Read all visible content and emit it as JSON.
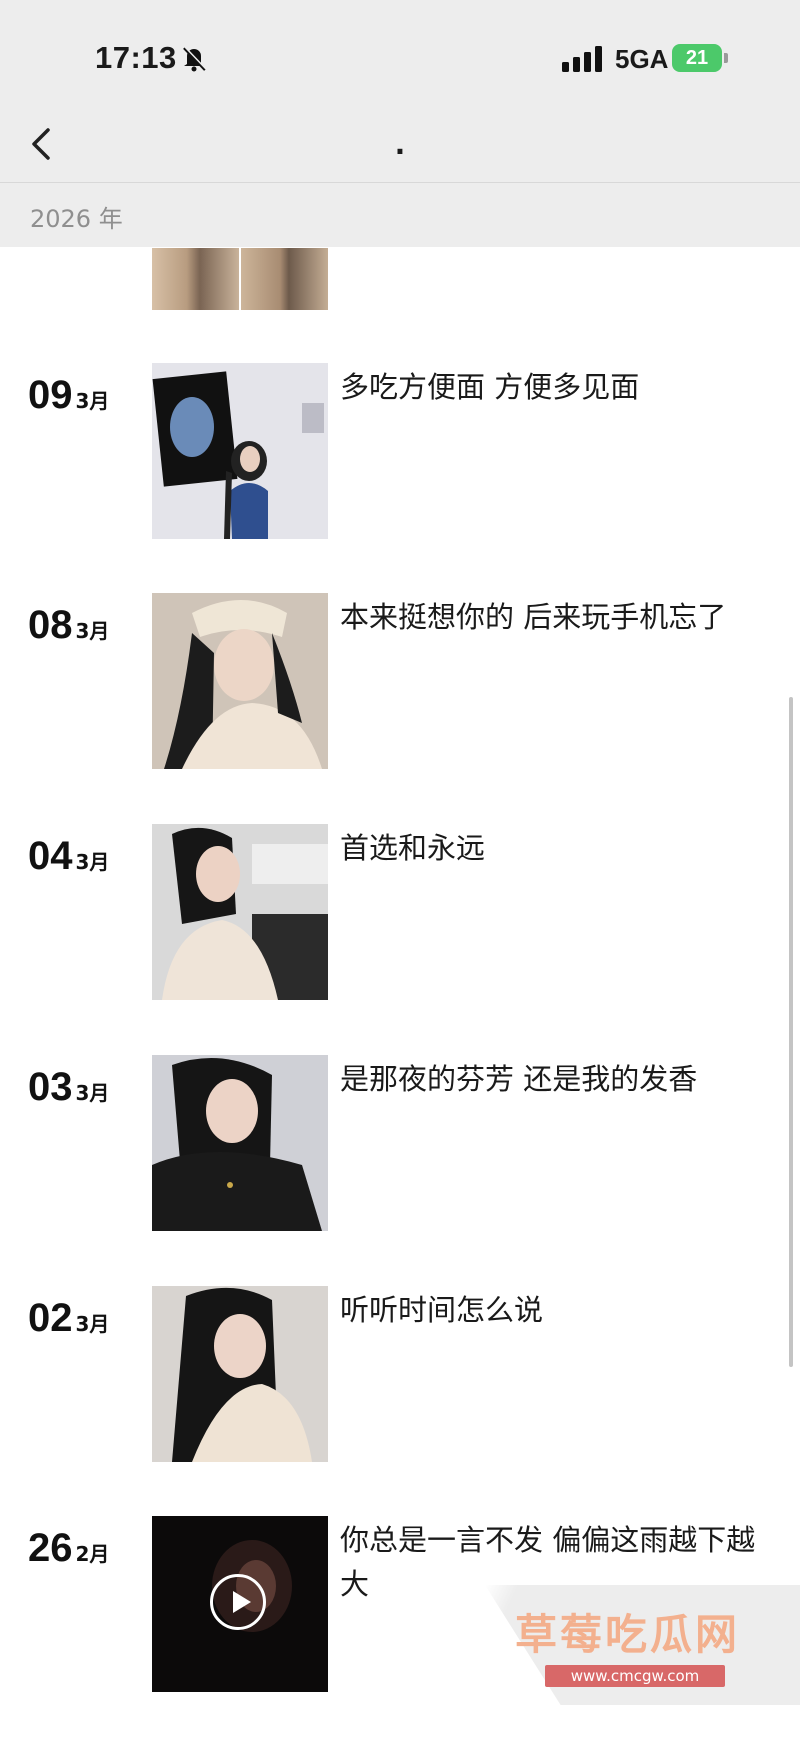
{
  "status": {
    "time": "17:13",
    "network": "5GA",
    "battery": "21"
  },
  "nav": {
    "title": "."
  },
  "year_label": "2026 年",
  "entries": [
    {
      "day": "09",
      "month": "3月",
      "caption": "多吃方便面 方便多见面"
    },
    {
      "day": "08",
      "month": "3月",
      "caption": "本来挺想你的 后来玩手机忘了"
    },
    {
      "day": "04",
      "month": "3月",
      "caption": "首选和永远"
    },
    {
      "day": "03",
      "month": "3月",
      "caption": "是那夜的芬芳 还是我的发香"
    },
    {
      "day": "02",
      "month": "3月",
      "caption": "听听时间怎么说"
    },
    {
      "day": "26",
      "month": "2月",
      "caption": "你总是一言不发 偏偏这雨越下越大"
    }
  ],
  "watermark": {
    "name": "草莓吃瓜网",
    "url": "www.cmcgw.com"
  },
  "colors": {
    "bar_bg": "#ededed",
    "battery": "#4cc96a",
    "watermark": "#f3b08e"
  },
  "icons": [
    "bell-slash-icon",
    "signal-icon",
    "back-chevron-icon",
    "play-icon"
  ]
}
